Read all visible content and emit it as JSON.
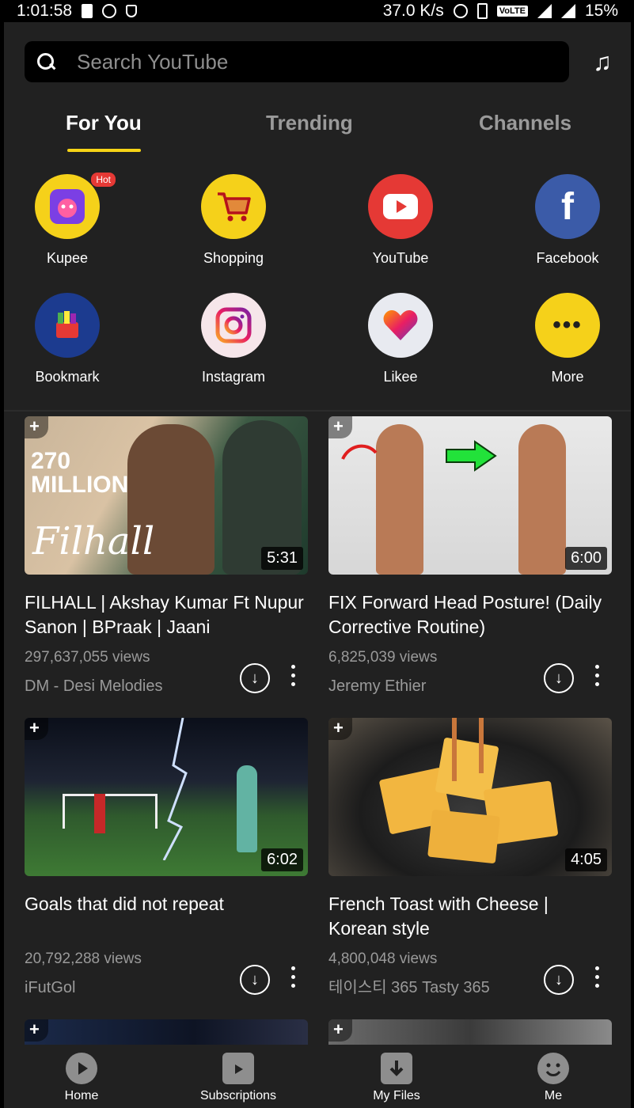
{
  "status_bar": {
    "time": "1:01:58",
    "speed": "37.0 K/s",
    "network_badge": "VoLTE",
    "battery": "15%"
  },
  "search": {
    "placeholder": "Search YouTube"
  },
  "tabs": [
    {
      "label": "For You",
      "active": true
    },
    {
      "label": "Trending",
      "active": false
    },
    {
      "label": "Channels",
      "active": false
    }
  ],
  "shortcuts": [
    {
      "label": "Kupee",
      "badge": "Hot",
      "icon": "kupee-icon",
      "color": "#f5d11a"
    },
    {
      "label": "Shopping",
      "icon": "shopping-cart-icon",
      "color": "#f5d11a"
    },
    {
      "label": "YouTube",
      "icon": "youtube-icon",
      "color": "#e53935"
    },
    {
      "label": "Facebook",
      "icon": "facebook-icon",
      "color": "#3b5ba8"
    },
    {
      "label": "Bookmark",
      "icon": "bookmark-icon",
      "color": "#1c3b8f"
    },
    {
      "label": "Instagram",
      "icon": "instagram-icon",
      "color": "#f6e6ea"
    },
    {
      "label": "Likee",
      "icon": "likee-icon",
      "color": "#e8eaf0"
    },
    {
      "label": "More",
      "icon": "more-dots-icon",
      "color": "#f5d11a"
    }
  ],
  "videos": [
    {
      "title": "FILHALL | Akshay Kumar Ft Nupur Sanon | BPraak | Jaani",
      "views": "297,637,055 views",
      "channel": "DM - Desi Melodies",
      "duration": "5:31",
      "thumb_text": "270 MILLION",
      "thumb_script": "Filhall"
    },
    {
      "title": "FIX Forward Head Posture! (Daily Corrective Routine)",
      "views": "6,825,039 views",
      "channel": "Jeremy Ethier",
      "duration": "6:00"
    },
    {
      "title": "Goals that did not repeat",
      "views": "20,792,288 views",
      "channel": "iFutGol",
      "duration": "6:02"
    },
    {
      "title": "French Toast with Cheese | Korean style",
      "views": "4,800,048 views",
      "channel": "테이스티 365 Tasty 365",
      "duration": "4:05"
    }
  ],
  "bottom_nav": [
    {
      "label": "Home",
      "icon": "home-play-icon"
    },
    {
      "label": "Subscriptions",
      "icon": "subscriptions-icon"
    },
    {
      "label": "My Files",
      "icon": "my-files-icon"
    },
    {
      "label": "Me",
      "icon": "me-smile-icon"
    }
  ]
}
